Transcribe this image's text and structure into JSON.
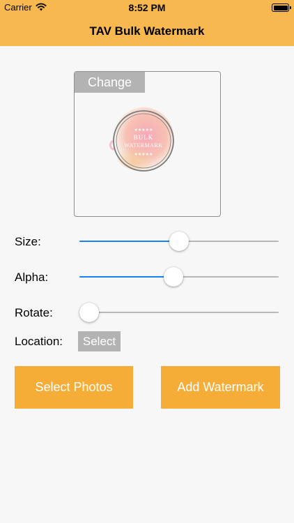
{
  "status_bar": {
    "carrier": "Carrier",
    "time": "8:52 PM",
    "wifi_icon": "wifi-icon",
    "battery_icon": "battery-icon"
  },
  "nav": {
    "title": "TAV Bulk Watermark",
    "background": "#f7b84f"
  },
  "preview": {
    "change_label": "Change",
    "watermark_text_line1": "BULK",
    "watermark_text_line2": "WATERMARK",
    "watermark_stars": "★★★★★"
  },
  "controls": {
    "size": {
      "label": "Size:",
      "value": 0.5
    },
    "alpha": {
      "label": "Alpha:",
      "value": 0.47
    },
    "rotate": {
      "label": "Rotate:",
      "value": 0.0
    },
    "location": {
      "label": "Location:",
      "select_label": "Select"
    }
  },
  "actions": {
    "select_photos": "Select Photos",
    "add_watermark": "Add Watermark",
    "color": "#f6ad37"
  },
  "colors": {
    "slider_fill": "#1a7ff3",
    "slider_track": "#b7b7b7",
    "gray_button": "#b3b3b3"
  }
}
